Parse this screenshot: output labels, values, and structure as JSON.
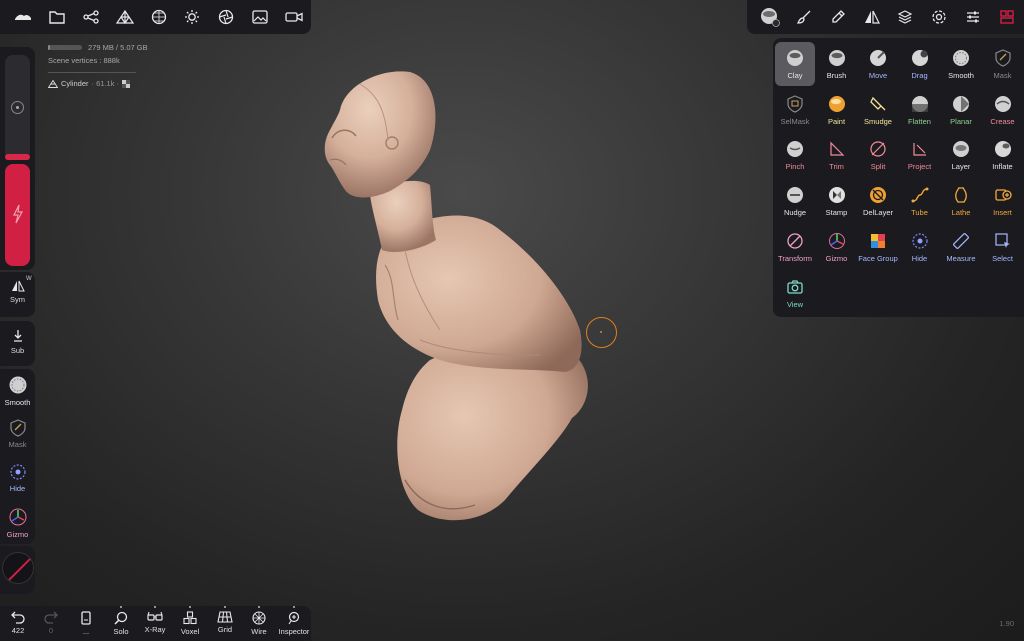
{
  "top_toolbar_left": {
    "buttons": [
      {
        "name": "nomad-logo",
        "icon": "nomad-logo-icon"
      },
      {
        "name": "files",
        "icon": "folder-icon"
      },
      {
        "name": "scene",
        "icon": "scene-graph-icon"
      },
      {
        "name": "topology",
        "icon": "topology-pyramid-icon"
      },
      {
        "name": "material",
        "icon": "material-sphere-icon"
      },
      {
        "name": "lighting",
        "icon": "sun-icon"
      },
      {
        "name": "postprocess",
        "icon": "aperture-icon"
      },
      {
        "name": "background",
        "icon": "image-icon"
      },
      {
        "name": "camera",
        "icon": "video-camera-icon"
      }
    ]
  },
  "top_toolbar_right": {
    "buttons": [
      {
        "name": "current-tool",
        "icon": "clay-sphere-icon"
      },
      {
        "name": "painting",
        "icon": "paintbrush-icon"
      },
      {
        "name": "stroke",
        "icon": "pen-icon"
      },
      {
        "name": "symmetry",
        "icon": "symmetry-triangle-icon"
      },
      {
        "name": "layers",
        "icon": "layers-icon"
      },
      {
        "name": "settings",
        "icon": "gear-icon"
      },
      {
        "name": "tool-settings",
        "icon": "sliders-icon"
      },
      {
        "name": "interface",
        "icon": "interface-grid-icon"
      }
    ]
  },
  "stats": {
    "memory": "279 MB / 5.07 GB",
    "memory_usage_fraction": 0.06,
    "scene_vertices_label": "Scene vertices :",
    "scene_vertices_value": "888k",
    "mesh_name": "Cylinder",
    "mesh_detail": "· 61.1k ·"
  },
  "left_panel": {
    "radius_fraction": 0.06,
    "intensity_fraction": 1.0,
    "sym_label": "Sym",
    "sym_badge": "W",
    "sub_label": "Sub",
    "quick_tools": [
      {
        "label": "Smooth",
        "color": "#e6e6e6"
      },
      {
        "label": "Mask",
        "color": "#8a8a8a"
      },
      {
        "label": "Hide",
        "color": "#a8b8ff"
      },
      {
        "label": "Gizmo",
        "color": "#f0a0c8"
      }
    ]
  },
  "bottom_toolbar": {
    "undo_count": "422",
    "redo_count": "0",
    "more_label": "...",
    "buttons": [
      "Solo",
      "X-Ray",
      "Voxel",
      "Grid",
      "Wire",
      "Inspector"
    ]
  },
  "version": "1.90",
  "tool_palette": {
    "selected": "Clay",
    "tools": [
      {
        "label": "Clay",
        "icon": "clay-sphere-icon",
        "color": "#e6e6e6"
      },
      {
        "label": "Brush",
        "icon": "brush-sphere-icon",
        "color": "#e6e6e6"
      },
      {
        "label": "Move",
        "icon": "move-sphere-icon",
        "color": "#a8b8ff"
      },
      {
        "label": "Drag",
        "icon": "drag-sphere-icon",
        "color": "#a8b8ff"
      },
      {
        "label": "Smooth",
        "icon": "smooth-sphere-icon",
        "color": "#e6e6e6"
      },
      {
        "label": "Mask",
        "icon": "mask-shield-icon",
        "color": "#8a8a8a"
      },
      {
        "label": "SelMask",
        "icon": "selmask-shield-icon",
        "color": "#8a8a8a"
      },
      {
        "label": "Paint",
        "icon": "paint-sphere-icon",
        "color": "#f3e39a"
      },
      {
        "label": "Smudge",
        "icon": "smudge-icon",
        "color": "#f3e39a"
      },
      {
        "label": "Flatten",
        "icon": "flatten-sphere-icon",
        "color": "#8fd18f"
      },
      {
        "label": "Planar",
        "icon": "planar-sphere-icon",
        "color": "#8fd18f"
      },
      {
        "label": "Crease",
        "icon": "crease-sphere-icon",
        "color": "#f08a9a"
      },
      {
        "label": "Pinch",
        "icon": "pinch-sphere-icon",
        "color": "#f08a9a"
      },
      {
        "label": "Trim",
        "icon": "trim-icon",
        "color": "#f08a9a"
      },
      {
        "label": "Split",
        "icon": "split-icon",
        "color": "#f08a9a"
      },
      {
        "label": "Project",
        "icon": "project-icon",
        "color": "#f08a9a"
      },
      {
        "label": "Layer",
        "icon": "layer-sphere-icon",
        "color": "#e6e6e6"
      },
      {
        "label": "Inflate",
        "icon": "inflate-sphere-icon",
        "color": "#e6e6e6"
      },
      {
        "label": "Nudge",
        "icon": "nudge-sphere-icon",
        "color": "#e6e6e6"
      },
      {
        "label": "Stamp",
        "icon": "stamp-sphere-icon",
        "color": "#e6e6e6"
      },
      {
        "label": "DelLayer",
        "icon": "dellayer-icon",
        "color": "#e6e6e6"
      },
      {
        "label": "Tube",
        "icon": "tube-icon",
        "color": "#f2a83c"
      },
      {
        "label": "Lathe",
        "icon": "lathe-icon",
        "color": "#f2a83c"
      },
      {
        "label": "Insert",
        "icon": "insert-icon",
        "color": "#f2a83c"
      },
      {
        "label": "Transform",
        "icon": "transform-icon",
        "color": "#f0a0c8"
      },
      {
        "label": "Gizmo",
        "icon": "gizmo-icon",
        "color": "#f0a0c8"
      },
      {
        "label": "Face Group",
        "icon": "face-group-icon",
        "color": "#a8b8ff"
      },
      {
        "label": "Hide",
        "icon": "hide-icon",
        "color": "#a8b8ff"
      },
      {
        "label": "Measure",
        "icon": "measure-icon",
        "color": "#a8b8ff"
      },
      {
        "label": "Select",
        "icon": "select-icon",
        "color": "#a8b8ff"
      },
      {
        "label": "View",
        "icon": "camera-icon",
        "color": "#7fd8c8"
      }
    ]
  }
}
